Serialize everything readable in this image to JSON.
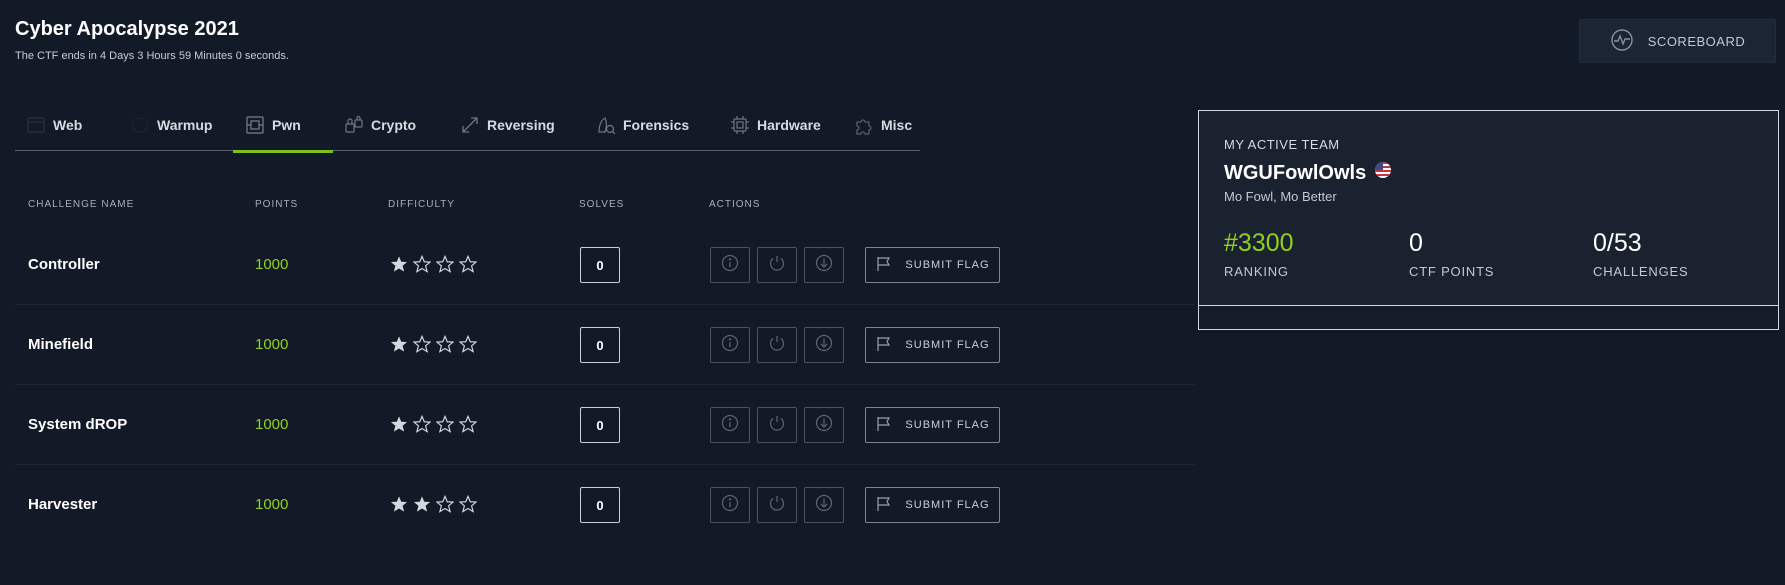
{
  "header": {
    "title": "Cyber Apocalypse 2021",
    "countdown": "The CTF ends in 4 Days 3 Hours 59 Minutes 0 seconds."
  },
  "scoreboard": {
    "label": "SCOREBOARD",
    "icon": "pulse-icon"
  },
  "tabs": [
    {
      "label": "Web",
      "icon": "web-icon",
      "active": false
    },
    {
      "label": "Warmup",
      "icon": "warmup-icon",
      "active": false
    },
    {
      "label": "Pwn",
      "icon": "pwn-icon",
      "active": true
    },
    {
      "label": "Crypto",
      "icon": "crypto-icon",
      "active": false
    },
    {
      "label": "Reversing",
      "icon": "reversing-icon",
      "active": false
    },
    {
      "label": "Forensics",
      "icon": "forensics-icon",
      "active": false
    },
    {
      "label": "Hardware",
      "icon": "hardware-icon",
      "active": false
    },
    {
      "label": "Misc",
      "icon": "misc-icon",
      "active": false
    }
  ],
  "table": {
    "headers": {
      "name": "CHALLENGE NAME",
      "points": "POINTS",
      "difficulty": "DIFFICULTY",
      "solves": "SOLVES",
      "actions": "ACTIONS"
    },
    "rows": [
      {
        "name": "Controller",
        "points": "1000",
        "difficulty": 1,
        "solves": "0"
      },
      {
        "name": "Minefield",
        "points": "1000",
        "difficulty": 1,
        "solves": "0"
      },
      {
        "name": "System dROP",
        "points": "1000",
        "difficulty": 1,
        "solves": "0"
      },
      {
        "name": "Harvester",
        "points": "1000",
        "difficulty": 2,
        "solves": "0"
      }
    ],
    "difficulty_max": 5,
    "submit_label": "SUBMIT FLAG"
  },
  "team": {
    "label": "MY ACTIVE TEAM",
    "name": "WGUFowlOwls",
    "flag_icon": "us-flag-icon",
    "motto": "Mo Fowl, Mo Better",
    "ranking": "#3300",
    "ranking_label": "RANKING",
    "points": "0",
    "points_label": "CTF POINTS",
    "challenges": "0/53",
    "challenges_label": "CHALLENGES"
  },
  "colors": {
    "background": "#131a27",
    "accent_green": "#8fd11e",
    "tab_underline": "#7fbf1b"
  }
}
